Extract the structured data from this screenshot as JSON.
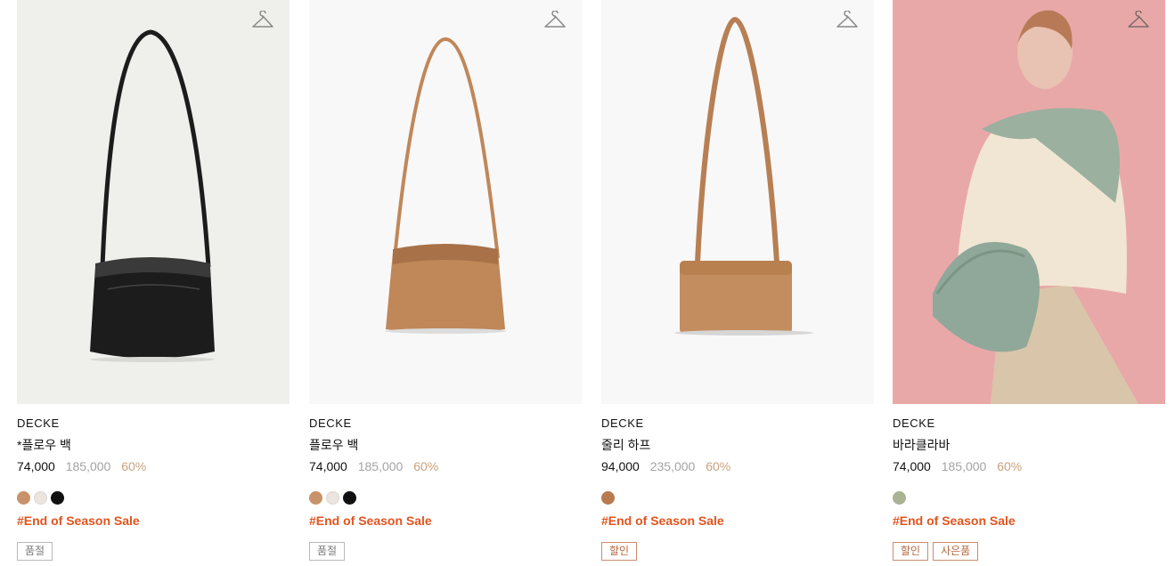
{
  "products": [
    {
      "brand": "DECKE",
      "name": "*플로우 백",
      "price": "74,000",
      "original_price": "185,000",
      "discount": "60%",
      "swatches": [
        "#c8936a",
        "#ebe5df",
        "#111111"
      ],
      "promo": "#End of Season Sale",
      "tags": [
        {
          "label": "품절",
          "kind": "soldout"
        }
      ],
      "image_bg": "#efefeb",
      "bag_color": "#1c1c1c"
    },
    {
      "brand": "DECKE",
      "name": "플로우 백",
      "price": "74,000",
      "original_price": "185,000",
      "discount": "60%",
      "swatches": [
        "#c8936a",
        "#ebe5df",
        "#111111"
      ],
      "promo": "#End of Season Sale",
      "tags": [
        {
          "label": "품절",
          "kind": "soldout"
        }
      ],
      "image_bg": "#f8f8f8",
      "bag_color": "#c08759"
    },
    {
      "brand": "DECKE",
      "name": "줄리 하프",
      "price": "94,000",
      "original_price": "235,000",
      "discount": "60%",
      "swatches": [
        "#b87a4f"
      ],
      "promo": "#End of Season Sale",
      "tags": [
        {
          "label": "할인",
          "kind": "sale"
        }
      ],
      "image_bg": "#f8f8f8",
      "bag_color": "#c48d5f"
    },
    {
      "brand": "DECKE",
      "name": "바라클라바",
      "price": "74,000",
      "original_price": "185,000",
      "discount": "60%",
      "swatches": [
        "#a9b394"
      ],
      "promo": "#End of Season Sale",
      "tags": [
        {
          "label": "할인",
          "kind": "sale"
        },
        {
          "label": "사은품",
          "kind": "sale"
        }
      ],
      "image_bg": "#e9a8a8",
      "bag_color": "#8fa899"
    }
  ],
  "icons": {
    "wishlist": "hanger-icon"
  },
  "colors": {
    "promo": "#e2541e",
    "discount": "#c9a27e",
    "original_price": "#a3a3a3"
  }
}
